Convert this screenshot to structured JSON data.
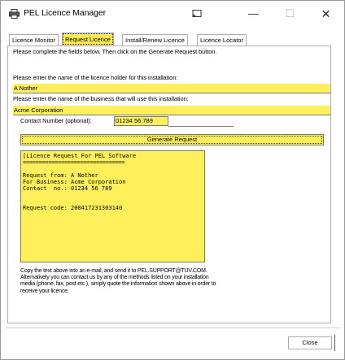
{
  "window": {
    "title": "PEL Licence Manager",
    "app_icon": "printer-icon",
    "cast_icon": "cast-icon",
    "minimize_label": "—",
    "maximize_label": "☐",
    "close_label": "✕"
  },
  "tabs": [
    {
      "label": "Licence Monitor",
      "active": false
    },
    {
      "label": "Request Licence",
      "active": true
    },
    {
      "label": "Install/Renew Licence",
      "active": false
    },
    {
      "label": "Licence Locator",
      "active": false
    }
  ],
  "form": {
    "instructions": "Please complete the fields below. Then click on the Generate Request button.",
    "holder_label": "Please enter the name of the licence holder for this installation:",
    "holder_value": "A Nother",
    "business_label": "Please enter the name of the business that will use this installation:",
    "business_value": "Acme Corporation",
    "contact_label": "Contact Number (optional):",
    "contact_value": "01234 56 789",
    "generate_label": "Generate Request"
  },
  "request_output": {
    "header": "[Licence Request For PEL Software",
    "separator": "================================",
    "lines": [
      "",
      "Request from: A Nother",
      "For Business: Acme Corporation",
      "Contact  no.: 01234 56 789",
      "",
      "",
      "Request code: 200417231303140"
    ]
  },
  "copy_note": {
    "line1": "Copy the text above into an e-mail, and send it to PEL.SUPPORT@TUV.COM.",
    "line2": "Alternatively you can contact us by any of the methods listed on your installation",
    "line3": "media (phone, fax, post etc.), simply quote the information shown above in order to",
    "line4": "receive your licence."
  },
  "footer": {
    "close_label": "Close"
  },
  "colors": {
    "highlight": "#ffef5a",
    "border": "#adadad"
  }
}
